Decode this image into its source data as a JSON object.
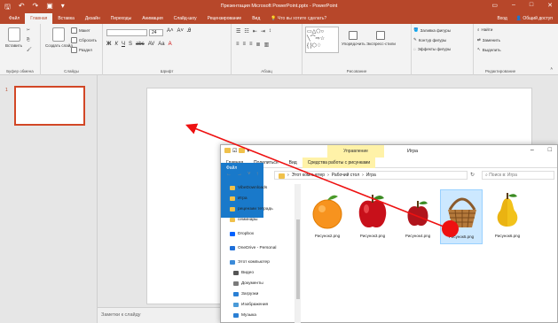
{
  "app": {
    "title": "Презентация Microsoft PowerPoint.pptx - PowerPoint",
    "accent": "#b7472a"
  },
  "ribbon": {
    "tabs": [
      "Файл",
      "Главная",
      "Вставка",
      "Дизайн",
      "Переходы",
      "Анимация",
      "Слайд-шоу",
      "Рецензирование",
      "Вид"
    ],
    "active_tab": "Главная",
    "tell_me": "Что вы хотите сделать?",
    "sign_in": "Вход",
    "share": "Общий доступ",
    "groups": {
      "clipboard": {
        "label": "Буфер обмена",
        "paste": "Вставить"
      },
      "slides": {
        "label": "Слайды",
        "new_slide": "Создать слайд",
        "layout": "Макет",
        "reset": "Сбросить",
        "section": "Раздел"
      },
      "font": {
        "label": "Шрифт",
        "size": "24"
      },
      "paragraph": {
        "label": "Абзац"
      },
      "drawing": {
        "label": "Рисование",
        "arrange": "Упорядочить",
        "quick_styles": "Экспресс-стили",
        "fill": "Заливка фигуры",
        "outline": "Контур фигуры",
        "effects": "Эффекты фигуры"
      },
      "editing": {
        "label": "Редактирование",
        "find": "Найти",
        "replace": "Заменить",
        "select": "Выделить"
      }
    }
  },
  "thumbnails": {
    "number": "1"
  },
  "notes": {
    "placeholder": "Заметки к слайду"
  },
  "explorer": {
    "title": "Игра",
    "manage_tab": "Управление",
    "tabs": [
      "Файл",
      "Главная",
      "Поделиться",
      "Вид",
      "Средства работы с рисунками"
    ],
    "path": [
      "Этот компьютер",
      "Рабочий стол",
      "Игра"
    ],
    "search_placeholder": "Поиск в: Игра",
    "nav": [
      {
        "label": "VibeDownloads",
        "icon": "folder-icon",
        "color": "#f0c14b"
      },
      {
        "label": "Игра",
        "icon": "folder-icon",
        "color": "#f0c14b"
      },
      {
        "label": "рецензии тетрадь",
        "icon": "folder-icon",
        "color": "#f0c14b"
      },
      {
        "label": "семинары",
        "icon": "folder-icon",
        "color": "#f0c14b"
      },
      {
        "label": "Dropbox",
        "icon": "dropbox-icon",
        "color": "#0061fe"
      },
      {
        "label": "OneDrive - Personal",
        "icon": "onedrive-icon",
        "color": "#1e6fd9"
      },
      {
        "label": "Этот компьютер",
        "icon": "computer-icon",
        "color": "#3c8bd9"
      },
      {
        "label": "Видео",
        "icon": "video-icon",
        "color": "#555"
      },
      {
        "label": "Документы",
        "icon": "documents-icon",
        "color": "#7a7a7a"
      },
      {
        "label": "Загрузки",
        "icon": "downloads-icon",
        "color": "#2a7fd4"
      },
      {
        "label": "Изображения",
        "icon": "pictures-icon",
        "color": "#4a9ad8"
      },
      {
        "label": "Музыка",
        "icon": "music-icon",
        "color": "#2a7fd4"
      }
    ],
    "files": [
      {
        "name": "Рисунок2.png",
        "kind": "orange-icon",
        "selected": false
      },
      {
        "name": "Рисунок3.png",
        "kind": "red-apple-icon",
        "selected": false
      },
      {
        "name": "Рисунок4.png",
        "kind": "small-apple-icon",
        "selected": false
      },
      {
        "name": "Рисунок5.png",
        "kind": "basket-icon",
        "selected": true
      },
      {
        "name": "Рисунок6.png",
        "kind": "pear-icon",
        "selected": false
      }
    ]
  },
  "annotation": {
    "color": "#ee1111"
  }
}
